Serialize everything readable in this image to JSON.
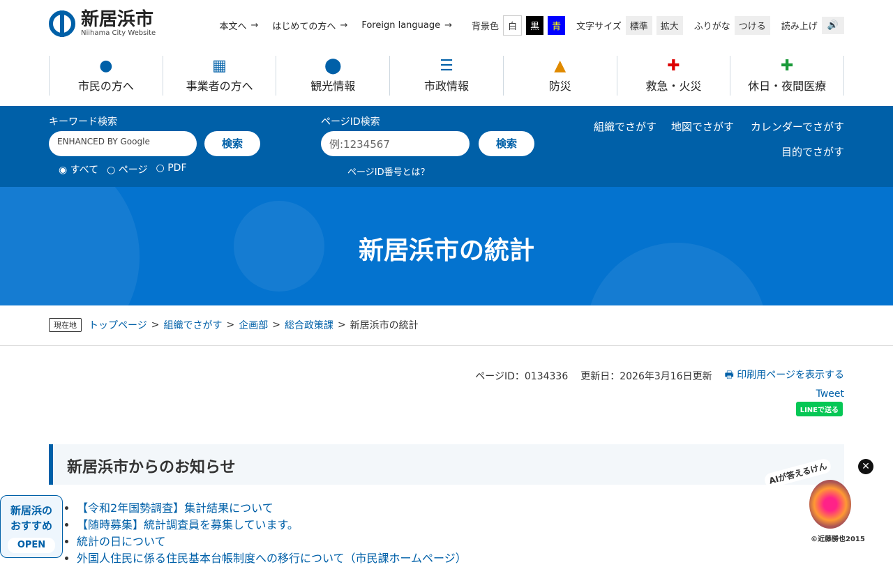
{
  "header": {
    "logo_title": "新居浜市",
    "logo_sub": "Niihama City Website",
    "links": [
      "本文へ",
      "はじめての方へ",
      "Foreign language"
    ],
    "bg_label": "背景色",
    "bg_options": [
      "白",
      "黒",
      "青"
    ],
    "font_label": "文字サイズ",
    "font_options": [
      "標準",
      "拡大"
    ],
    "furigana_label": "ふりがな",
    "furigana_button": "つける",
    "read_label": "読み上げ"
  },
  "nav": [
    {
      "label": "市民の方へ",
      "icon": "person-icon"
    },
    {
      "label": "事業者の方へ",
      "icon": "building-icon"
    },
    {
      "label": "観光情報",
      "icon": "map-pin-icon"
    },
    {
      "label": "市政情報",
      "icon": "list-icon"
    },
    {
      "label": "防災",
      "icon": "helmet-icon"
    },
    {
      "label": "救急・火災",
      "icon": "ambulance-icon"
    },
    {
      "label": "休日・夜間医療",
      "icon": "medical-kit-icon"
    }
  ],
  "search": {
    "keyword_label": "キーワード検索",
    "keyword_placeholder": "ENHANCED BY Google",
    "search_button": "検索",
    "radios": [
      "すべて",
      "ページ",
      "PDF"
    ],
    "pageid_label": "ページID検索",
    "pageid_placeholder": "例:1234567",
    "pageid_button": "検索",
    "pageid_help": "ページID番号とは？",
    "find_links": [
      "組織でさがす",
      "地図でさがす",
      "カレンダーでさがす",
      "目的でさがす"
    ]
  },
  "hero": {
    "title": "新居浜市の統計"
  },
  "breadcrumb": {
    "here": "現在地",
    "items": [
      "トップページ",
      "組織でさがす",
      "企画部",
      "総合政策課"
    ],
    "current": "新居浜市の統計"
  },
  "meta": {
    "page_id": "ページID：0134336",
    "updated": "更新日：2026年3月16日更新",
    "print": "印刷用ページを表示する",
    "tweet": "Tweet",
    "line": "LINEで送る"
  },
  "section": {
    "title": "新居浜市からのお知らせ",
    "items": [
      "【令和2年国勢調査】集計結果について",
      "【随時募集】統計調査員を募集しています。",
      "統計の日について",
      "外国人住民に係る住民基本台帳制度への移行について（市民課ホームページ）"
    ]
  },
  "osusume": {
    "line1": "新居浜の",
    "line2": "おすすめ",
    "open": "OPEN"
  },
  "ai": {
    "bubble": "AIが答えるけん",
    "copyright": "©近藤勝也2015"
  }
}
